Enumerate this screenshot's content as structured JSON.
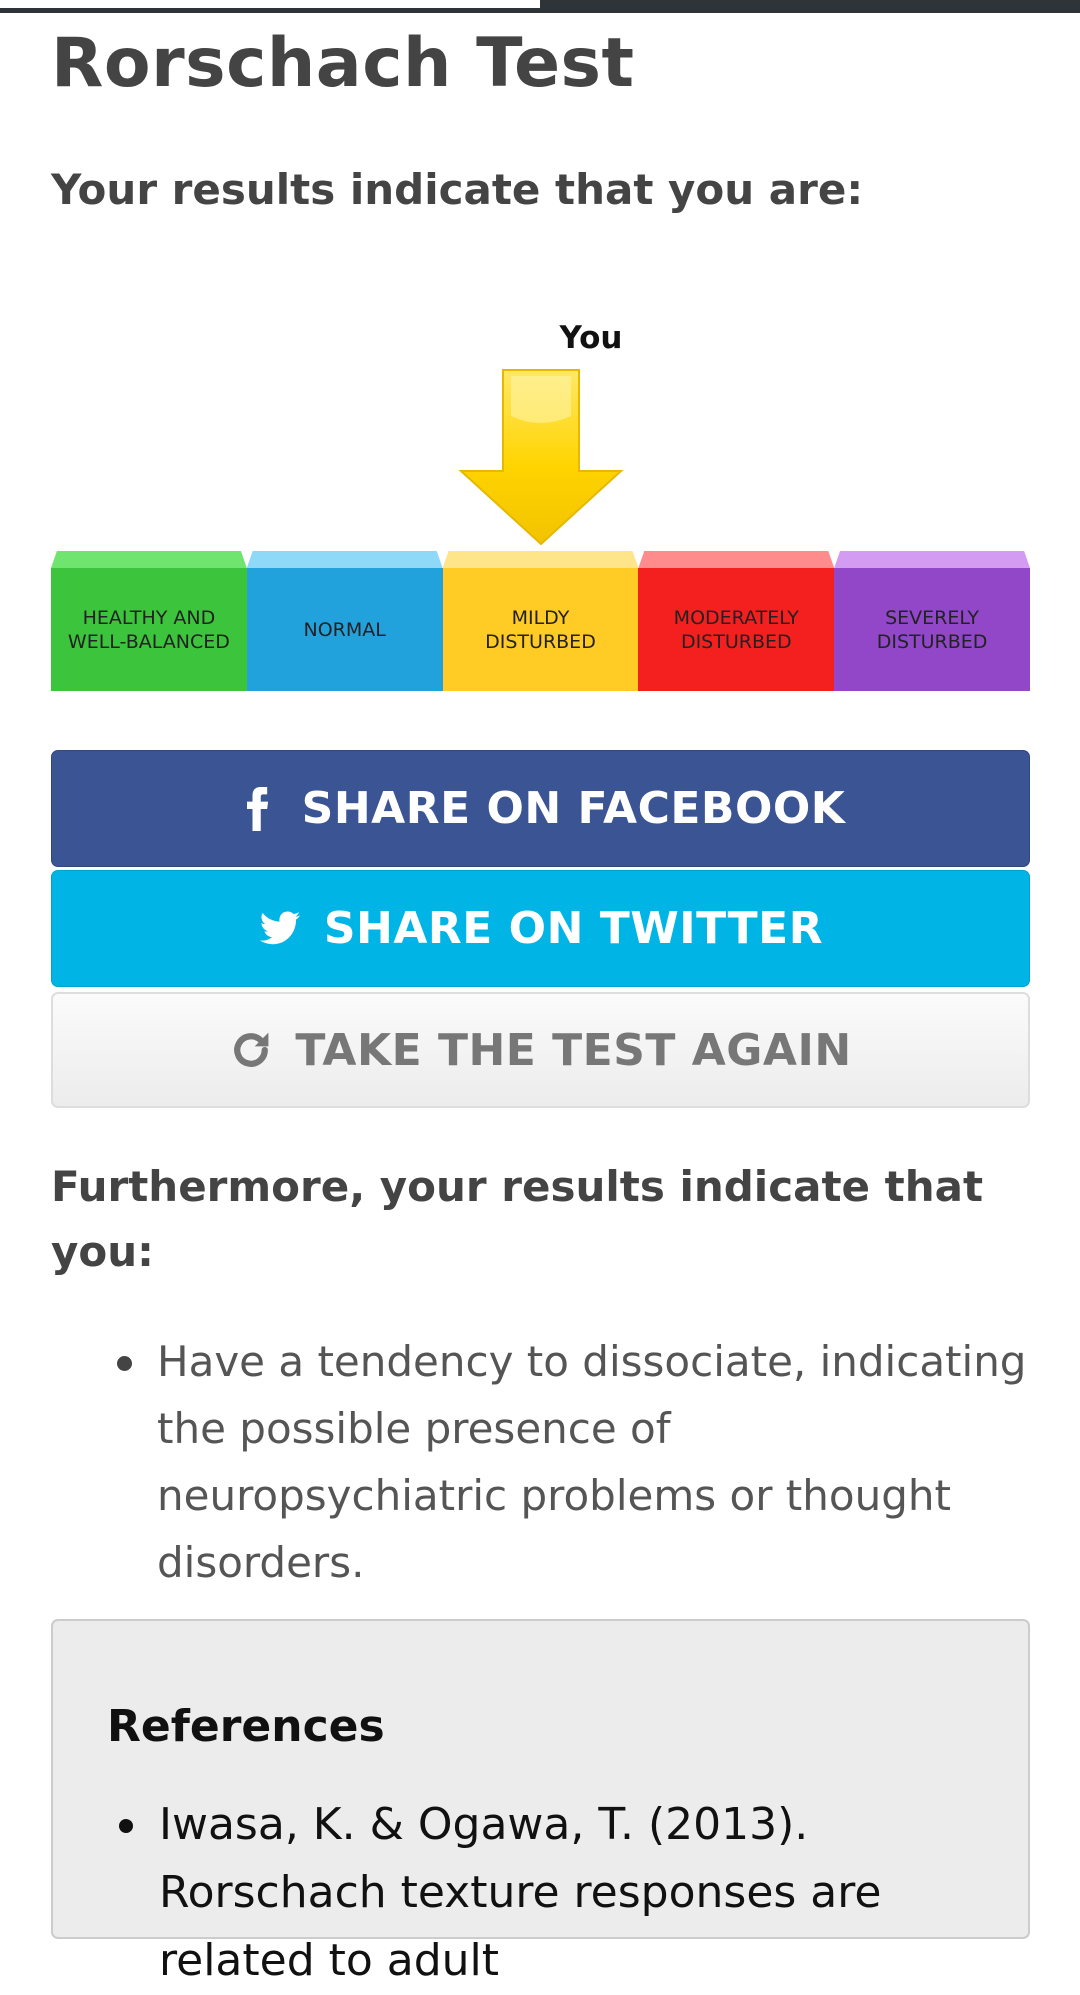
{
  "page": {
    "title": "Rorschach Test",
    "result_heading": "Your results indicate that you are:"
  },
  "reading_progress": 0.5,
  "scale": {
    "marker_label": "You",
    "selected_index": 2,
    "segments": [
      {
        "label": "HEALTHY AND\nWELL-BALANCED",
        "color": "#3cc43c",
        "cap_color": "#6fe56f"
      },
      {
        "label": "NORMAL",
        "color": "#22a2dc",
        "cap_color": "#8ed8f8"
      },
      {
        "label": "MILDY\nDISTURBED",
        "color": "#ffcb24",
        "cap_color": "#ffe58a"
      },
      {
        "label": "MODERATELY\nDISTURBED",
        "color": "#f41f1f",
        "cap_color": "#ff8c8c"
      },
      {
        "label": "SEVERELY\nDISTURBED",
        "color": "#9147c7",
        "cap_color": "#d49bf2"
      }
    ]
  },
  "buttons": {
    "facebook": {
      "label": "SHARE ON FACEBOOK",
      "icon": "facebook-icon"
    },
    "twitter": {
      "label": "SHARE ON TWITTER",
      "icon": "twitter-icon"
    },
    "retake": {
      "label": "TAKE THE TEST AGAIN",
      "icon": "refresh-icon"
    }
  },
  "further": {
    "heading": "Furthermore, your results indicate that you:",
    "items": [
      "Have a tendency to dissociate, indicating the possible presence of neuropsychiatric problems or thought disorders."
    ]
  },
  "references": {
    "title": "References",
    "items": [
      "Iwasa, K. & Ogawa, T. (2013). Rorschach texture responses are related to adult"
    ]
  }
}
